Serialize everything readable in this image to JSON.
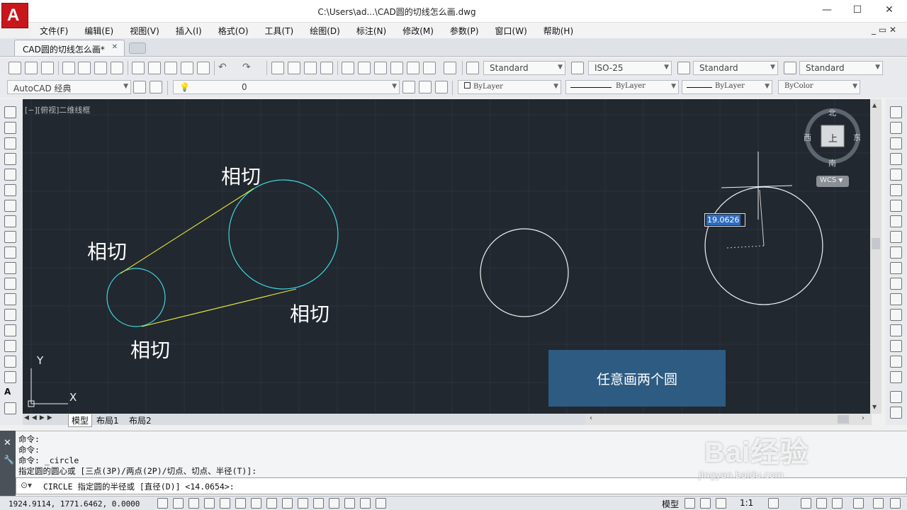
{
  "window": {
    "title": "C:\\Users\\ad...\\CAD圆的切线怎么画.dwg",
    "controls": [
      "—",
      "☐",
      "✕"
    ]
  },
  "menu": [
    "文件(F)",
    "编辑(E)",
    "视图(V)",
    "插入(I)",
    "格式(O)",
    "工具(T)",
    "绘图(D)",
    "标注(N)",
    "修改(M)",
    "参数(P)",
    "窗口(W)",
    "帮助(H)"
  ],
  "tabs": {
    "doc_tab": "CAD圆的切线怎么画*",
    "close": "✕"
  },
  "toolbar": {
    "text_style": "Standard",
    "dim_style": "ISO-25",
    "table_style": "Standard",
    "multileader_style": "Standard",
    "workspace": "AutoCAD 经典",
    "layer": "0",
    "color": "ByLayer",
    "linetype": "ByLayer",
    "lineweight": "ByLayer",
    "plot_style": "ByColor"
  },
  "viewport": {
    "label": "[−][俯视]二维线框"
  },
  "drawing": {
    "annotations": [
      "相切",
      "相切",
      "相切",
      "相切"
    ],
    "note": "任意画两个圆",
    "dim_input": "19.0626",
    "ucs": {
      "x": "X",
      "y": "Y"
    },
    "colors": {
      "cyan": "#3fd6dc",
      "yellow": "#e8e83a",
      "white": "#f2f2f2",
      "background": "#212830"
    }
  },
  "viewcube": {
    "north": "北",
    "south": "南",
    "east": "东",
    "west": "西",
    "top": "上",
    "wcs": "WCS"
  },
  "layout_tabs": [
    "模型",
    "布局1",
    "布局2"
  ],
  "command": {
    "history": [
      "命令:",
      "命令:",
      "命令: _circle",
      "指定圆的圆心或 [三点(3P)/两点(2P)/切点、切点、半径(T)]:"
    ],
    "prompt": "CIRCLE 指定圆的半径或 [直径(D)] <14.0654>:"
  },
  "status": {
    "coords": "1924.9114, 1771.6462, 0.0000",
    "model": "模型",
    "scale": "1:1"
  },
  "watermark": {
    "main": "Bai经验",
    "sub": "jingyan.baidu.com"
  }
}
